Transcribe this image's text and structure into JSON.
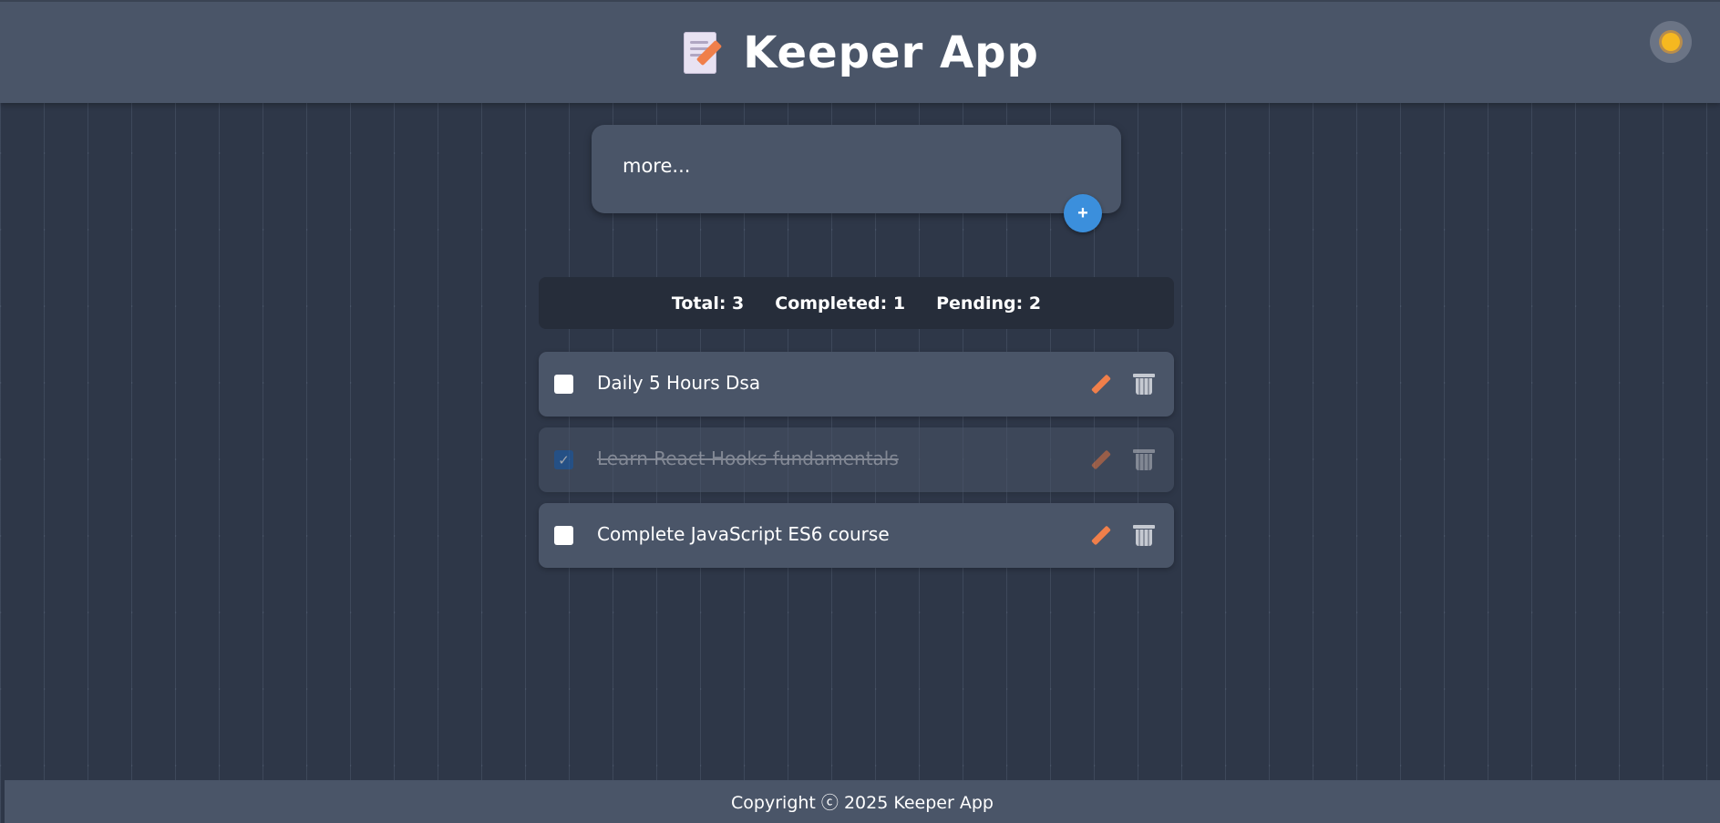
{
  "header": {
    "title": "Keeper App",
    "logo_icon": "memo-pencil-icon",
    "theme_toggle_icon": "sun-icon"
  },
  "note_form": {
    "placeholder": "more...",
    "add_label": "+"
  },
  "stats": {
    "total": "Total: 3",
    "completed": "Completed: 1",
    "pending": "Pending: 2"
  },
  "todos": [
    {
      "text": "Daily 5 Hours Dsa",
      "completed": false
    },
    {
      "text": "Learn React Hooks fundamentals",
      "completed": true,
      "check_mark": "✓"
    },
    {
      "text": "Complete JavaScript ES6 course",
      "completed": false
    }
  ],
  "footer": {
    "text": "Copyright ⓒ 2025 Keeper App"
  },
  "colors": {
    "background": "#2e3748",
    "surface": "#4a5568",
    "stats_bg": "#262d3a",
    "accent": "#3b8fdc",
    "edit_icon": "#f07f4a"
  }
}
